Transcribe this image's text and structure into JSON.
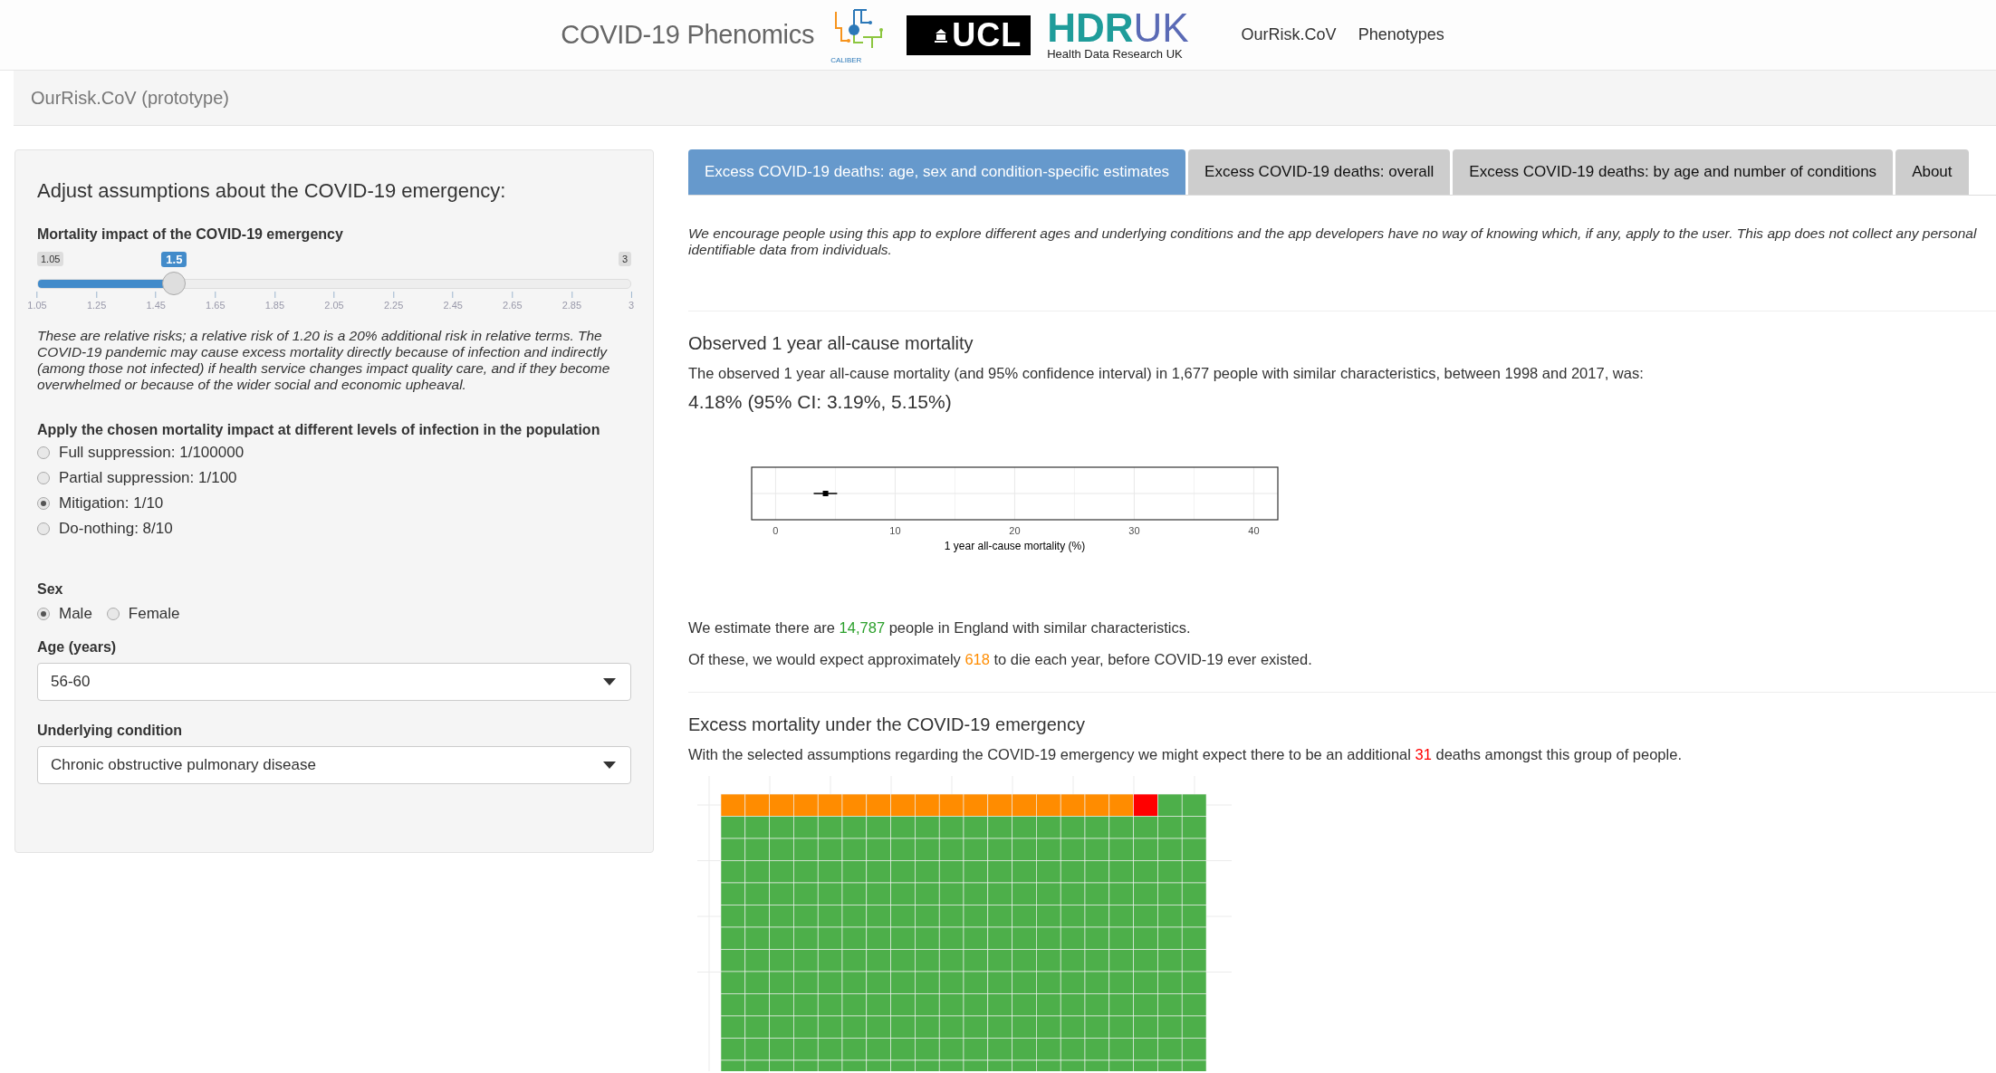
{
  "header": {
    "title": "COVID-19 Phenomics",
    "logos": [
      {
        "kind": "caliber",
        "text": "CALIBER"
      },
      {
        "kind": "ucl",
        "text": "UCL"
      },
      {
        "kind": "hdruk",
        "parts": [
          "HDR",
          "UK"
        ],
        "caption": "Health Data Research UK"
      }
    ],
    "nav": [
      "OurRisk.CoV",
      "Phenotypes"
    ]
  },
  "app_bar": {
    "title": "OurRisk.CoV (prototype)"
  },
  "sidebar": {
    "heading": "Adjust assumptions about the COVID-19 emergency:",
    "slider": {
      "label": "Mortality impact of the COVID-19 emergency",
      "min": "1.05",
      "max": "3",
      "value": "1.5",
      "level": 0.2308,
      "ticks": [
        "1.05",
        "1.25",
        "1.45",
        "1.65",
        "1.85",
        "2.05",
        "2.25",
        "2.45",
        "2.65",
        "2.85",
        "3"
      ]
    },
    "note": "These are relative risks; a relative risk of 1.20 is a 20% additional risk in relative terms. The COVID-19 pandemic may cause excess mortality directly because of infection and indirectly (among those not infected) if health service changes impact quality care, and if they become overwhelmed or because of the wider social and economic upheaval.",
    "infection": {
      "label": "Apply the chosen mortality impact at different levels of infection in the population",
      "options": [
        {
          "label": "Full suppression: 1/100000",
          "selected": false
        },
        {
          "label": "Partial suppression: 1/100",
          "selected": false
        },
        {
          "label": "Mitigation: 1/10",
          "selected": true
        },
        {
          "label": "Do-nothing: 8/10",
          "selected": false
        }
      ]
    },
    "sex": {
      "label": "Sex",
      "options": [
        {
          "label": "Male",
          "selected": true
        },
        {
          "label": "Female",
          "selected": false
        }
      ]
    },
    "age": {
      "label": "Age (years)",
      "value": "56-60"
    },
    "condition": {
      "label": "Underlying condition",
      "value": "Chronic obstructive pulmonary disease"
    }
  },
  "tabs": [
    {
      "label": "Excess COVID-19 deaths: age, sex and condition-specific estimates",
      "selected": true
    },
    {
      "label": "Excess COVID-19 deaths: overall",
      "selected": false
    },
    {
      "label": "Excess COVID-19 deaths: by age and number of conditions",
      "selected": false
    },
    {
      "label": "About",
      "selected": false
    }
  ],
  "disclaimer": "We encourage people using this app to explore different ages and underlying conditions and the app developers have no way of knowing which, if any, apply to the user. This app does not collect any personal identifiable data from individuals.",
  "observed": {
    "heading": "Observed 1 year all-cause mortality",
    "text": "The observed 1 year all-cause mortality (and 95% confidence interval) in 1,677 people with similar characteristics, between 1998 and 2017, was:",
    "result": "4.18% (95% CI: 3.19%, 5.15%)",
    "plot": {
      "axis_title": "1 year all-cause mortality (%)",
      "ticks": [
        "0",
        "10",
        "20",
        "30",
        "40"
      ]
    },
    "statements": [
      {
        "before": "We estimate there are ",
        "value": "14,787",
        "after": " people in England with similar characteristics.",
        "color": "#2ca02c"
      },
      {
        "before": "Of these, we would expect approximately ",
        "value": "618",
        "after": " to die each year, before COVID-19 ever existed.",
        "color": "#ff8c00"
      }
    ]
  },
  "excess": {
    "heading": "Excess mortality under the COVID-19 emergency",
    "statement": {
      "before": "With the selected assumptions regarding the COVID-19 emergency we might expect there to be an additional ",
      "value": "31",
      "after": " deaths amongst this group of people.",
      "color": "#ff0000"
    }
  }
}
